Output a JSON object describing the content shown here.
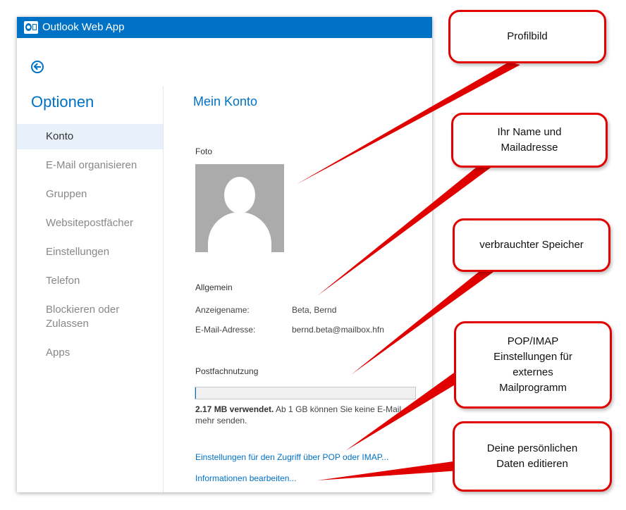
{
  "app": {
    "title": "Outlook Web App",
    "logo_icon": "outlook-logo-icon",
    "accent": "#0072c6"
  },
  "sidebar": {
    "title": "Optionen",
    "back_icon": "back-arrow-icon",
    "items": [
      {
        "label": "Konto",
        "active": true
      },
      {
        "label": "E-Mail organisieren"
      },
      {
        "label": "Gruppen"
      },
      {
        "label": "Websitepostfächer"
      },
      {
        "label": "Einstellungen"
      },
      {
        "label": "Telefon"
      },
      {
        "label": "Blockieren oder\nZulassen"
      },
      {
        "label": "Apps"
      }
    ]
  },
  "main": {
    "title": "Mein Konto",
    "photo_label": "Foto",
    "general_label": "Allgemein",
    "display_name_label": "Anzeigename:",
    "display_name_value": "Beta, Bernd",
    "email_label": "E-Mail-Adresse:",
    "email_value": "bernd.beta@mailbox.hfn",
    "mailbox_usage_label": "Postfachnutzung",
    "usage_fraction": 0.002,
    "usage_bold": "2.17 MB verwendet.",
    "usage_text": " Ab 1 GB können Sie keine E-Mail",
    "usage_text2": "mehr senden.",
    "pop_imap_link": "Einstellungen für den Zugriff über POP oder IMAP...",
    "edit_info_link": "Informationen bearbeiten..."
  },
  "callouts": {
    "profile": "Profilbild",
    "name_mail": "Ihr Name und\nMailadresse",
    "storage": "verbrauchter Speicher",
    "pop_imap": "POP/IMAP\nEinstellungen  für\nexternes\nMailprogramm",
    "personal": "Deine persönlichen\nDaten editieren",
    "border_color": "#e00000"
  }
}
